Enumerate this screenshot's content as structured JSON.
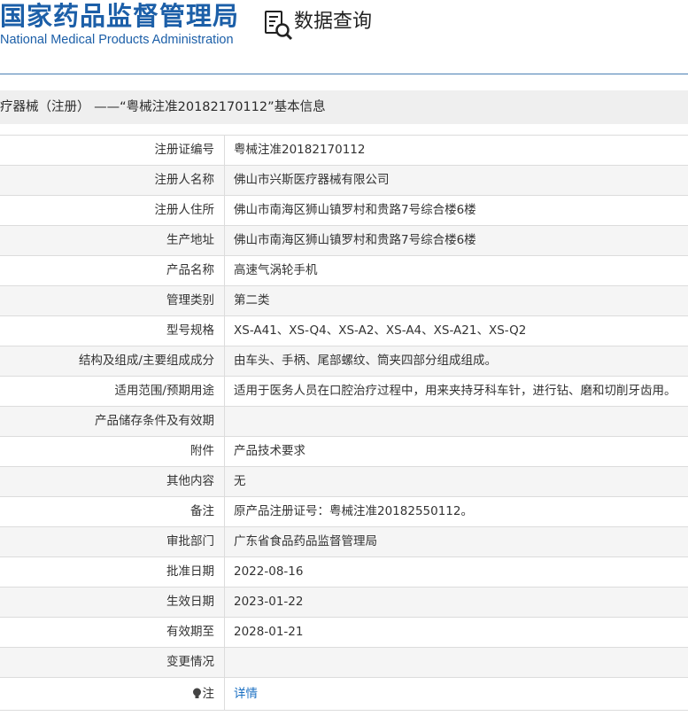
{
  "header": {
    "brand_cn": "国家药品监督管理局",
    "brand_en": "National Medical Products Administration",
    "query_title": "数据查询",
    "query_icon": "document-search-icon"
  },
  "page_title": "疗器械（注册） ——“粤械注准20182170112”基本信息",
  "rows": [
    {
      "label": "注册证编号",
      "value": "粤械注准20182170112"
    },
    {
      "label": "注册人名称",
      "value": "佛山市兴斯医疗器械有限公司"
    },
    {
      "label": "注册人住所",
      "value": "佛山市南海区狮山镇罗村和贵路7号综合楼6楼"
    },
    {
      "label": "生产地址",
      "value": "佛山市南海区狮山镇罗村和贵路7号综合楼6楼"
    },
    {
      "label": "产品名称",
      "value": "高速气涡轮手机"
    },
    {
      "label": "管理类别",
      "value": "第二类"
    },
    {
      "label": "型号规格",
      "value": "XS-A41、XS-Q4、XS-A2、XS-A4、XS-A21、XS-Q2"
    },
    {
      "label": "结构及组成/主要组成成分",
      "value": "由车头、手柄、尾部螺纹、筒夹四部分组成组成。"
    },
    {
      "label": "适用范围/预期用途",
      "value": "适用于医务人员在口腔治疗过程中，用来夹持牙科车针，进行钻、磨和切削牙齿用。"
    },
    {
      "label": "产品储存条件及有效期",
      "value": ""
    },
    {
      "label": "附件",
      "value": "产品技术要求"
    },
    {
      "label": "其他内容",
      "value": "无"
    },
    {
      "label": "备注",
      "value": "原产品注册证号：粤械注准20182550112。"
    },
    {
      "label": "审批部门",
      "value": "广东省食品药品监督管理局"
    },
    {
      "label": "批准日期",
      "value": "2022-08-16"
    },
    {
      "label": "生效日期",
      "value": "2023-01-22"
    },
    {
      "label": "有效期至",
      "value": "2028-01-21"
    },
    {
      "label": "变更情况",
      "value": ""
    }
  ],
  "note_row": {
    "label": "注",
    "icon": "lightbulb-icon",
    "link_text": "详情"
  }
}
